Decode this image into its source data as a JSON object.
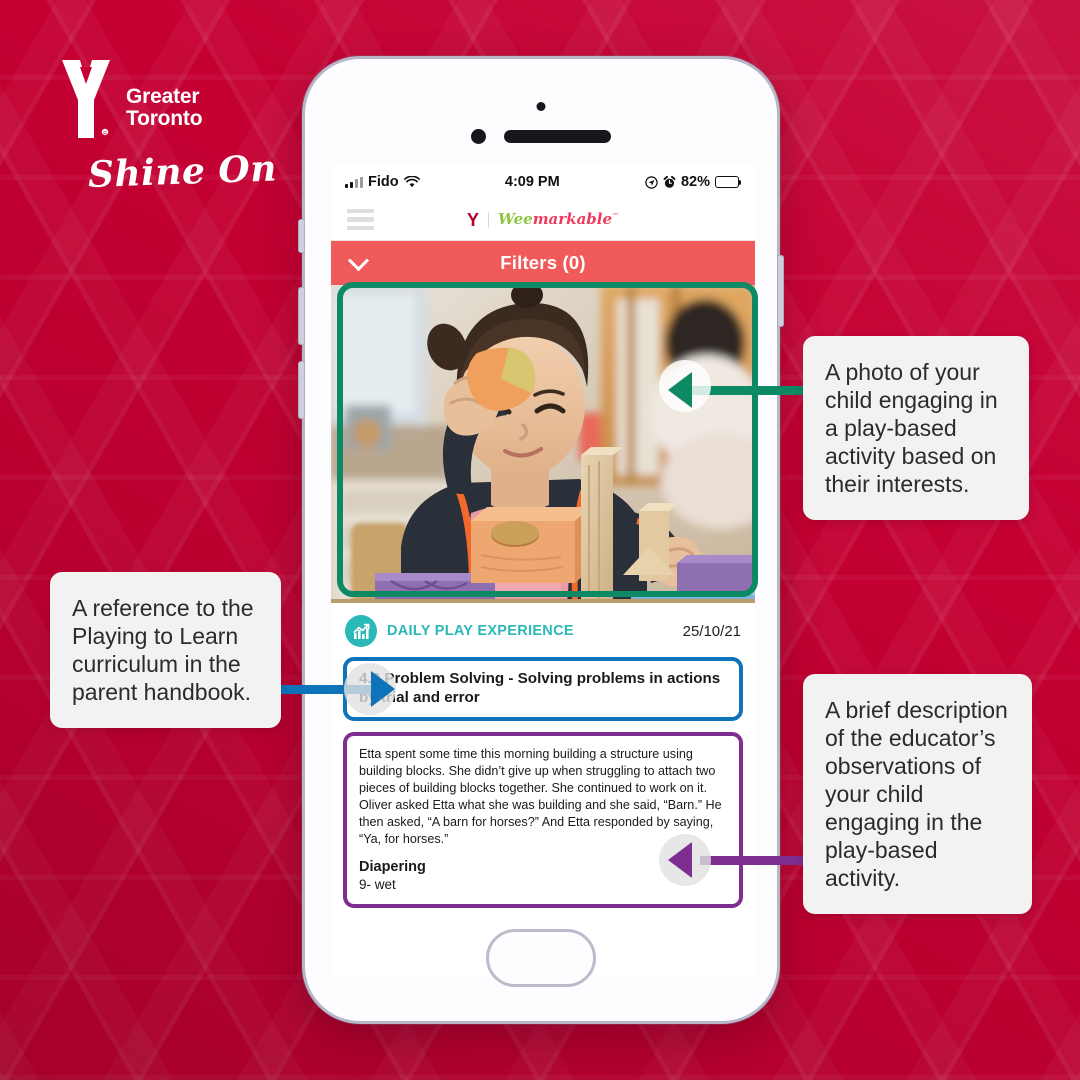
{
  "brand": {
    "org_line1": "Greater",
    "org_line2": "Toronto",
    "tagline": "Shine On",
    "logo_icon": "ymca-y-logo"
  },
  "phone": {
    "status_bar": {
      "carrier": "Fido",
      "wifi_icon": "wifi-icon",
      "signal_icon": "cellular-signal-icon",
      "time": "4:09 PM",
      "location_icon": "location-arrow-icon",
      "alarm_icon": "alarm-clock-icon",
      "battery_percent": "82%",
      "battery_icon": "battery-icon"
    },
    "app_header": {
      "menu_icon": "hamburger-menu-icon",
      "brand_y": "Y",
      "brand_wee": "Wee",
      "brand_markable": "markable",
      "brand_tm": "™"
    },
    "filters": {
      "label": "Filters (0)",
      "chevron_icon": "chevron-down-icon"
    },
    "photo": {
      "alt": "Toddler in dark jacket and pink bib playing with wooden building blocks at a table"
    },
    "entry": {
      "category_icon": "growth-chart-icon",
      "category_label": "DAILY PLAY EXPERIENCE",
      "date": "25/10/21",
      "outcome": "4.2 Problem Solving - Solving problems in actions by trial and error",
      "observation": "Etta spent some time this morning building a structure using building blocks. She didn’t give up when struggling to attach two pieces of building blocks together. She continued to work on it. Oliver asked Etta what she was building and she said, “Barn.” He then asked, “A barn for horses?” And Etta responded by saying, “Ya, for horses.”",
      "diapering_heading": "Diapering",
      "diapering_value": "9- wet"
    },
    "home_button_icon": "home-button"
  },
  "callouts": {
    "photo": "A photo of your child engaging in a play-based activity based on their interests.",
    "curriculum": "A reference to the Playing to Learn curriculum in the parent handbook.",
    "observation": "A brief description of the educator’s observations of your child engaging in the play-based activity."
  },
  "colors": {
    "background_red": "#C50033",
    "filters_red": "#F15A5A",
    "highlight_green": "#0D8A63",
    "highlight_blue": "#0E73B8",
    "highlight_purple": "#7E2E90",
    "teal_accent": "#2BB8B8",
    "brand_y_red": "#B3002D",
    "wee_green": "#8CC63F",
    "markable_pink": "#EE3B5B"
  }
}
